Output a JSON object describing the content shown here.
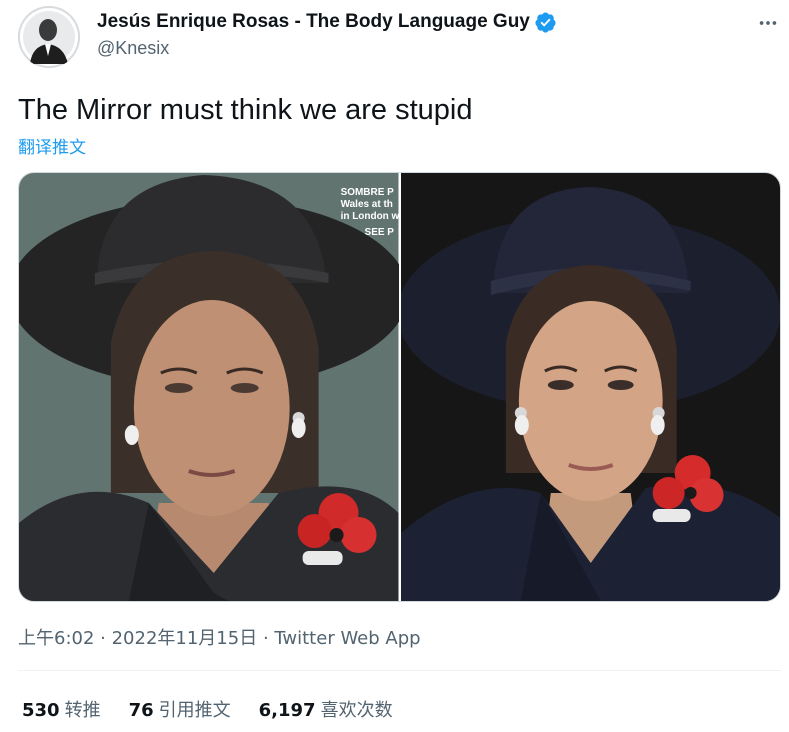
{
  "author": {
    "display_name": "Jesús Enrique Rosas - The Body Language Guy",
    "handle": "@Knesix",
    "verified": true,
    "avatar_icon": "profile-photo"
  },
  "tweet": {
    "text": "The Mirror must think we are stupid",
    "translate_label": "翻译推文"
  },
  "media": {
    "left_photo_caption": {
      "line1": "SOMBRE P",
      "line2": "Wales at th",
      "line3": "in London w",
      "line4": "SEE P"
    }
  },
  "meta": {
    "time": "上午6:02",
    "separator": " · ",
    "date": "2022年11月15日",
    "source": "Twitter Web App"
  },
  "stats": {
    "retweets_count": "530",
    "retweets_label": "转推",
    "quotes_count": "76",
    "quotes_label": "引用推文",
    "likes_count": "6,197",
    "likes_label": "喜欢次数"
  },
  "colors": {
    "accent": "#1d9bf0",
    "text_primary": "#0f1419",
    "text_secondary": "#536471",
    "border": "#cfd9de"
  }
}
